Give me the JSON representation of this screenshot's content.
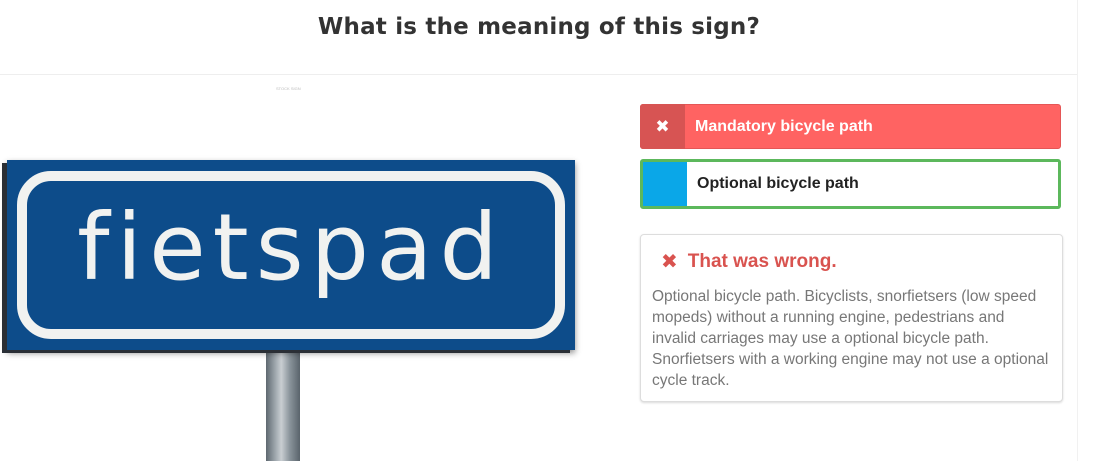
{
  "question": {
    "title": "What is the meaning of this sign?"
  },
  "sign": {
    "text": "fietspad",
    "credit": "STOCK SIGN",
    "colors": {
      "board": "#0d4c8a",
      "text": "#f1f2f0"
    }
  },
  "answers": [
    {
      "label": "Mandatory bicycle path",
      "state": "selected-wrong",
      "icon": "close-icon"
    },
    {
      "label": "Optional bicycle path",
      "state": "correct"
    }
  ],
  "feedback": {
    "icon": "x-icon",
    "title": "That was wrong.",
    "body": "Optional bicycle path. Bicyclists, snorfietsers (low speed mopeds) without a running engine, pedestrians and invalid carriages may use a optional bicycle path. Snorfietsers with a working engine may not use a optional cycle track."
  },
  "colors": {
    "wrong": "#ff6362",
    "wrong_dark": "#d75453",
    "correct_border": "#5cb85c",
    "answer_marker": "#0aa7e8",
    "feedback_title": "#d9534f"
  }
}
